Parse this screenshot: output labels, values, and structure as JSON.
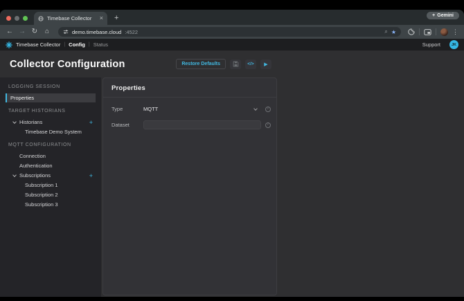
{
  "browser": {
    "tab": {
      "title": "Timebase Collector",
      "close_glyph": "×",
      "new_tab_glyph": "+"
    },
    "gemini": {
      "plus": "+",
      "label": "Gemini"
    },
    "toolbar": {
      "back": "←",
      "forward": "→",
      "reload": "↻",
      "home": "⌂",
      "magnifier": "⌕",
      "star": "★",
      "kebab": "⋮"
    },
    "url": {
      "host": "demo.timebase.cloud",
      "port": ":4522"
    }
  },
  "app": {
    "nav": {
      "brand": "Timebase Collector",
      "sep": "|",
      "config": "Config",
      "status": "Status",
      "support": "Support",
      "avatar_initials": "JK"
    },
    "page": {
      "title": "Collector Configuration",
      "restore_defaults": "Restore Defaults",
      "code_glyph": "</>",
      "play_glyph": "▶"
    },
    "sidebar": {
      "sections": [
        {
          "label": "LOGGING SESSION",
          "items": [
            {
              "label": "Properties"
            }
          ]
        },
        {
          "label": "TARGET HISTORIANS",
          "items": [
            {
              "label": "Historians",
              "add": "+"
            },
            {
              "label": "Timebase Demo System"
            }
          ]
        },
        {
          "label": "MQTT CONFIGURATION",
          "items": [
            {
              "label": "Connection"
            },
            {
              "label": "Authentication"
            },
            {
              "label": "Subscriptions",
              "add": "+"
            },
            {
              "label": "Subscription 1"
            },
            {
              "label": "Subscription 2"
            },
            {
              "label": "Subscription 3"
            }
          ]
        }
      ]
    },
    "panel": {
      "title": "Properties",
      "fields": [
        {
          "label": "Type",
          "value": "MQTT"
        },
        {
          "label": "Dataset",
          "value": ""
        }
      ]
    }
  },
  "colors": {
    "accent": "#41b9e2",
    "panel_bg": "#323236",
    "sidebar_bg": "#242428",
    "chrome_bg": "#3e4447"
  }
}
